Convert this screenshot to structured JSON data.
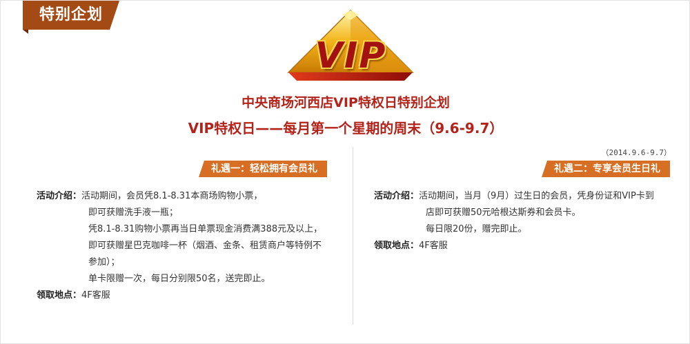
{
  "corner_tag": "特别企划",
  "logo_text": "VIP",
  "colors": {
    "corner_tag_bg": "#a34a15",
    "title_red": "#b4231a",
    "badge_orange": "#d66f23",
    "logo_gold": "#f6d44c",
    "logo_red": "#a31210"
  },
  "titles": {
    "line1": "中央商场河西店VIP特权日特别企划",
    "line2": "VIP特权日——每月第一个星期的周末（9.6-9.7）"
  },
  "date_note": "（2014.9.6-9.7）",
  "gift1": {
    "badge": "礼遇一：轻松拥有会员礼",
    "intro_label": "活动介绍：",
    "intro_lines": [
      "活动期间，会员凭8.1-8.31本商场购物小票，",
      "即可获赠洗手液一瓶；",
      "凭8.1-8.31购物小票再当日单票现金消费满388元及以上，",
      "即可获赠星巴克咖啡一杯（烟酒、金条、租赁商户等特例不",
      "参加）；",
      "单卡限赠一次，每日分别限50名，送完即止。"
    ],
    "location_label": "领取地点：",
    "location": "4F客服"
  },
  "gift2": {
    "badge": "礼遇二：专享会员生日礼",
    "intro_label": "活动介绍：",
    "intro_lines": [
      "活动期间，当月（9月）过生日的会员，凭身份证和VIP卡到",
      "店即可获赠50元哈根达斯券和会员卡。",
      "每日限20份，赠完即止。"
    ],
    "location_label": "领取地点：",
    "location": "4F客服"
  }
}
